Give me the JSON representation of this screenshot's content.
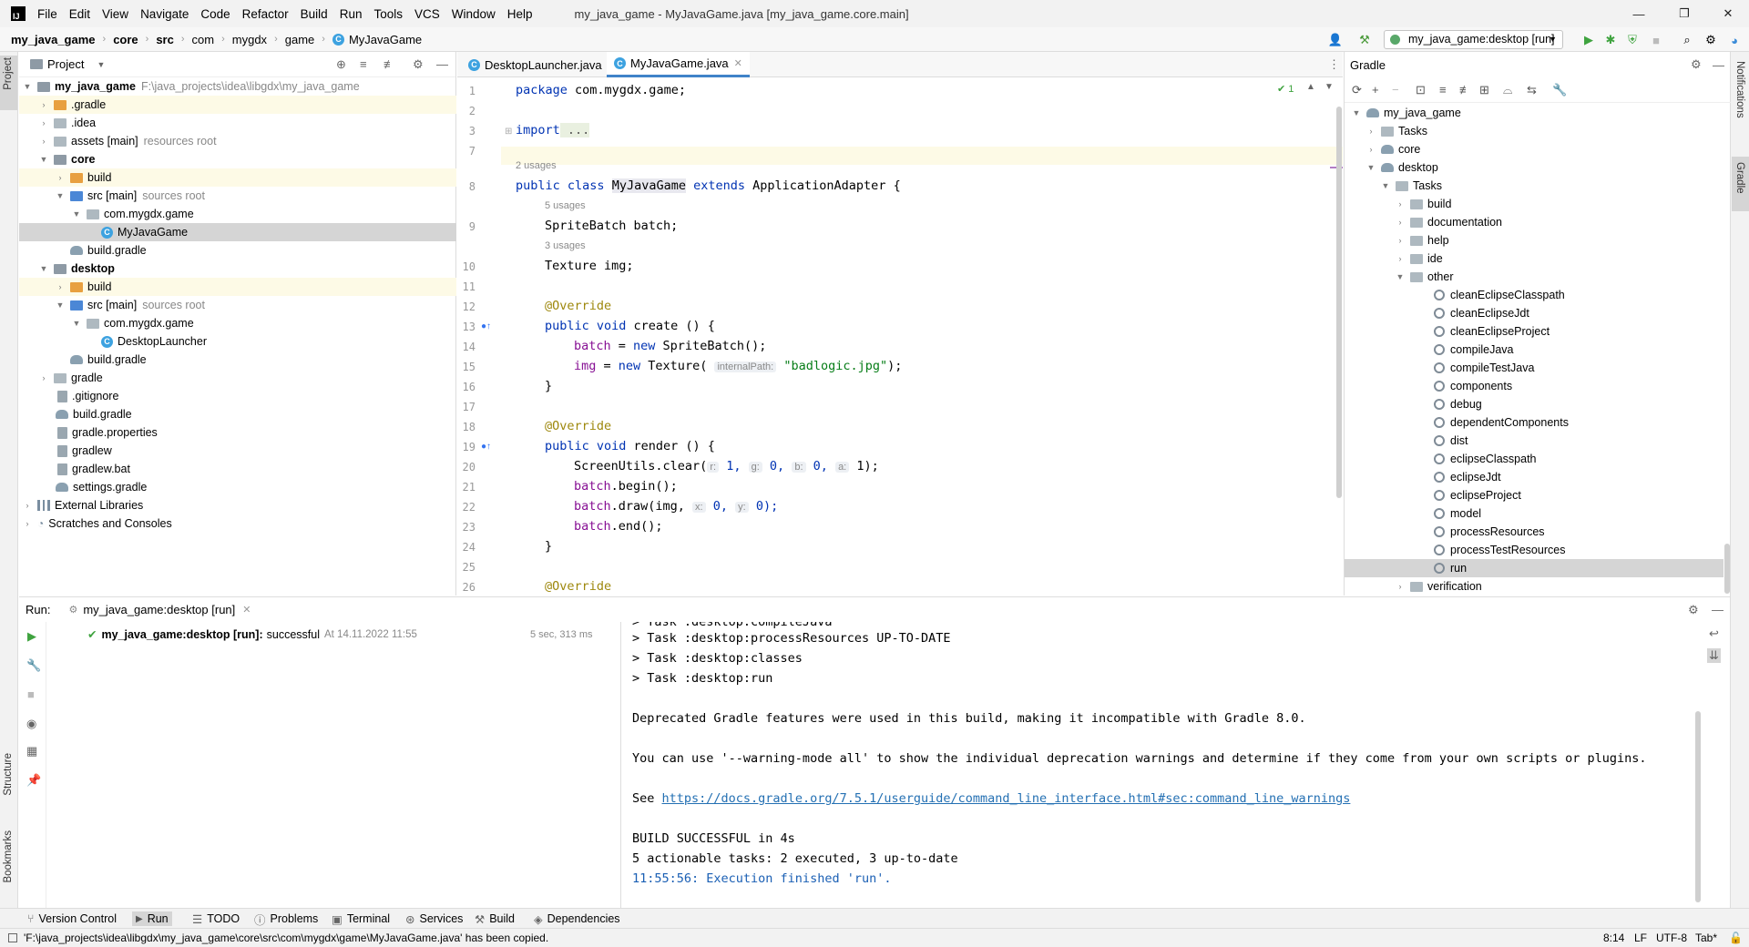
{
  "titlebar": {
    "menus": [
      "File",
      "Edit",
      "View",
      "Navigate",
      "Code",
      "Refactor",
      "Build",
      "Run",
      "Tools",
      "VCS",
      "Window",
      "Help"
    ],
    "title": "my_java_game - MyJavaGame.java [my_java_game.core.main]",
    "minimize": "—",
    "maximize": "❐",
    "close": "✕"
  },
  "navbar": {
    "crumbs": [
      "my_java_game",
      "core",
      "src",
      "com",
      "mygdx",
      "game",
      "MyJavaGame"
    ],
    "run_config": "my_java_game:desktop [run]"
  },
  "left_strip": {
    "project": "Project",
    "structure": "Structure",
    "bookmarks": "Bookmarks"
  },
  "right_strip": {
    "notifications": "Notifications",
    "gradle": "Gradle"
  },
  "project": {
    "header": "Project",
    "root_name": "my_java_game",
    "root_path": "F:\\java_projects\\idea\\libgdx\\my_java_game",
    "rows": [
      {
        "label": ".gradle"
      },
      {
        "label": ".idea"
      },
      {
        "label": "assets [main]",
        "hint": "resources root"
      },
      {
        "label": "core"
      },
      {
        "label": "build"
      },
      {
        "label": "src [main]",
        "hint": "sources root"
      },
      {
        "label": "com.mygdx.game"
      },
      {
        "label": "MyJavaGame"
      },
      {
        "label": "build.gradle"
      },
      {
        "label": "desktop"
      },
      {
        "label": "build"
      },
      {
        "label": "src [main]",
        "hint": "sources root"
      },
      {
        "label": "com.mygdx.game"
      },
      {
        "label": "DesktopLauncher"
      },
      {
        "label": "build.gradle"
      },
      {
        "label": "gradle"
      },
      {
        "label": ".gitignore"
      },
      {
        "label": "build.gradle"
      },
      {
        "label": "gradle.properties"
      },
      {
        "label": "gradlew"
      },
      {
        "label": "gradlew.bat"
      },
      {
        "label": "settings.gradle"
      },
      {
        "label": "External Libraries"
      },
      {
        "label": "Scratches and Consoles"
      }
    ]
  },
  "editor": {
    "tabs": [
      "DesktopLauncher.java",
      "MyJavaGame.java"
    ],
    "tab_close": "✕",
    "inspection": "✔ 1",
    "lines": {
      "l1": "1",
      "l2": "2",
      "l3": "3",
      "l7": "7",
      "l8": "8",
      "l9": "9",
      "l10": "10",
      "l11": "11",
      "l12": "12",
      "l13": "13",
      "l14": "14",
      "l15": "15",
      "l16": "16",
      "l17": "17",
      "l18": "18",
      "l19": "19",
      "l20": "20",
      "l21": "21",
      "l22": "22",
      "l23": "23",
      "l24": "24",
      "l25": "25",
      "l26": "26"
    },
    "usages": {
      "u1": "2 usages",
      "u2": "5 usages",
      "u3": "3 usages"
    },
    "code": {
      "c1a": "package",
      "c1b": " com.mygdx.game;",
      "c3a": "import",
      "c3b": " ...",
      "c8a": "public class",
      "c8b": "MyJavaGame",
      "c8c": "extends",
      "c8d": " ApplicationAdapter {",
      "c9": "SpriteBatch batch;",
      "c10": "Texture img;",
      "c12": "@Override",
      "c13a": "public void",
      "c13b": " create () {",
      "c14a": "batch",
      "c14b": " = ",
      "c14c": "new",
      "c14d": " SpriteBatch();",
      "c15a": "img",
      "c15b": " = ",
      "c15c": "new",
      "c15d": " Texture(",
      "c15hint": "internalPath:",
      "c15str": "\"badlogic.jpg\"",
      "c15e": ");",
      "c16": "}",
      "c18": "@Override",
      "c19a": "public void",
      "c19b": " render () {",
      "c20a": "ScreenUtils.clear(",
      "c20h1": "r:",
      "c20v1": "1,",
      "c20h2": "g:",
      "c20v2": "0,",
      "c20h3": "b:",
      "c20v3": "0,",
      "c20h4": "a:",
      "c20v4": "1);",
      "c21a": "batch",
      ".c21b": "",
      "c21b": ".begin();",
      "c22a": "batch",
      "c22b": ".draw(img, ",
      "c22h1": "x:",
      "c22v1": "0, ",
      "c22h2": "y:",
      "c22v2": "0);",
      "c23a": "batch",
      "c23b": ".end();",
      "c24": "}",
      "c26": "@Override"
    }
  },
  "gradle": {
    "header": "Gradle",
    "rows": [
      {
        "label": "my_java_game"
      },
      {
        "label": "Tasks"
      },
      {
        "label": "core"
      },
      {
        "label": "desktop"
      },
      {
        "label": "Tasks"
      },
      {
        "label": "build"
      },
      {
        "label": "documentation"
      },
      {
        "label": "help"
      },
      {
        "label": "ide"
      },
      {
        "label": "other"
      },
      {
        "label": "cleanEclipseClasspath"
      },
      {
        "label": "cleanEclipseJdt"
      },
      {
        "label": "cleanEclipseProject"
      },
      {
        "label": "compileJava"
      },
      {
        "label": "compileTestJava"
      },
      {
        "label": "components"
      },
      {
        "label": "debug"
      },
      {
        "label": "dependentComponents"
      },
      {
        "label": "dist"
      },
      {
        "label": "eclipseClasspath"
      },
      {
        "label": "eclipseJdt"
      },
      {
        "label": "eclipseProject"
      },
      {
        "label": "model"
      },
      {
        "label": "processResources"
      },
      {
        "label": "processTestResources"
      },
      {
        "label": "run"
      },
      {
        "label": "verification"
      }
    ]
  },
  "run": {
    "label": "Run:",
    "tab": "my_java_game:desktop [run]",
    "result_name": "my_java_game:desktop [run]:",
    "result_status": "successful",
    "result_time": "At 14.11.2022 11:55",
    "duration": "5 sec, 313 ms",
    "console": {
      "cut": "> Task :desktop:compileJava",
      "l1": "> Task :desktop:processResources UP-TO-DATE",
      "l2": "> Task :desktop:classes",
      "l3": "> Task :desktop:run",
      "l4": "Deprecated Gradle features were used in this build, making it incompatible with Gradle 8.0.",
      "l5": "You can use '--warning-mode all' to show the individual deprecation warnings and determine if they come from your own scripts or plugins.",
      "l6a": "See ",
      "l6link": "https://docs.gradle.org/7.5.1/userguide/command_line_interface.html#sec:command_line_warnings",
      "l7": "BUILD SUCCESSFUL in 4s",
      "l8": "5 actionable tasks: 2 executed, 3 up-to-date",
      "l9": "11:55:56: Execution finished 'run'."
    }
  },
  "bottom_tabs": [
    "Version Control",
    "Run",
    "TODO",
    "Problems",
    "Terminal",
    "Services",
    "Build",
    "Dependencies"
  ],
  "status": {
    "message": "'F:\\java_projects\\idea\\libgdx\\my_java_game\\core\\src\\com\\mygdx\\game\\MyJavaGame.java' has been copied.",
    "position": "8:14",
    "line_sep": "LF",
    "encoding": "UTF-8",
    "indent": "Tab*"
  }
}
